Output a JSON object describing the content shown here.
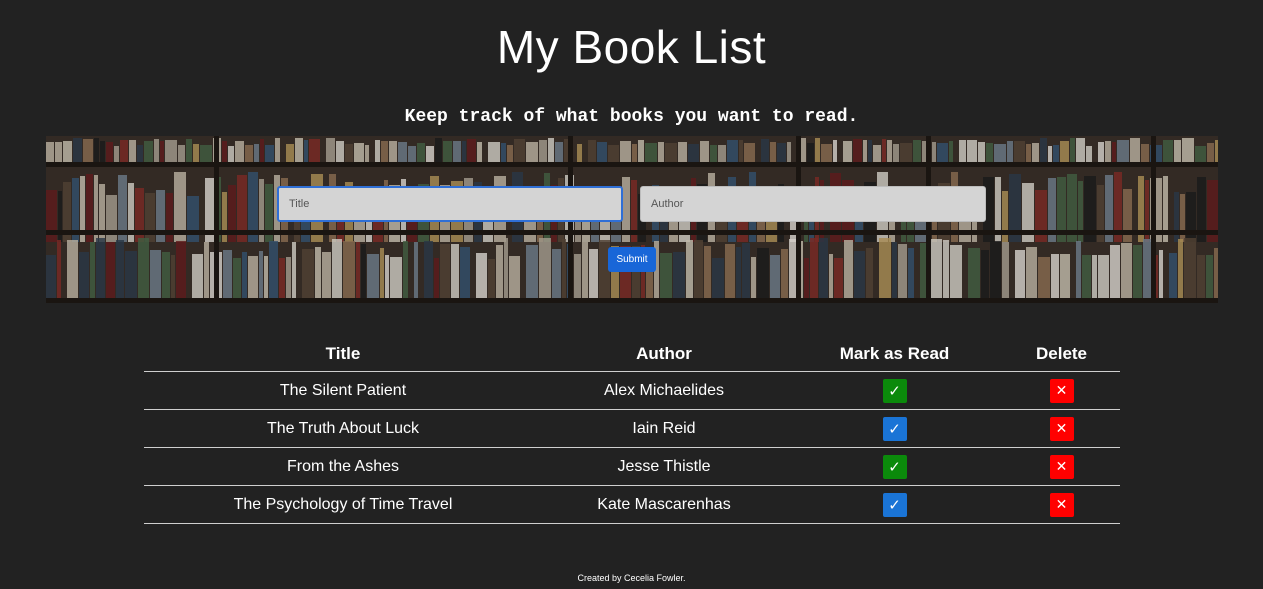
{
  "header": {
    "title": "My Book List",
    "tagline": "Keep track of what books you want to read."
  },
  "form": {
    "title_placeholder": "Title",
    "title_value": "",
    "author_placeholder": "Author",
    "author_value": "",
    "submit_label": "Submit"
  },
  "table": {
    "headers": [
      "Title",
      "Author",
      "Mark as Read",
      "Delete"
    ],
    "rows": [
      {
        "title": "The Silent Patient",
        "author": "Alex Michaelides",
        "read": true
      },
      {
        "title": "The Truth About Luck",
        "author": "Iain Reid",
        "read": false
      },
      {
        "title": "From the Ashes",
        "author": "Jesse Thistle",
        "read": true
      },
      {
        "title": "The Psychology of Time Travel",
        "author": "Kate Mascarenhas",
        "read": false
      }
    ],
    "mark_glyph": "✓",
    "delete_glyph": "✕"
  },
  "footer": {
    "credit": "Created by Cecelia Fowler."
  },
  "colors": {
    "background": "#222222",
    "read_button": "#0b8a0b",
    "unread_button": "#1a74d6",
    "delete_button": "#ff0000",
    "submit_button": "#1866d8"
  },
  "icons": {
    "mark": "check-icon",
    "delete": "close-icon"
  }
}
